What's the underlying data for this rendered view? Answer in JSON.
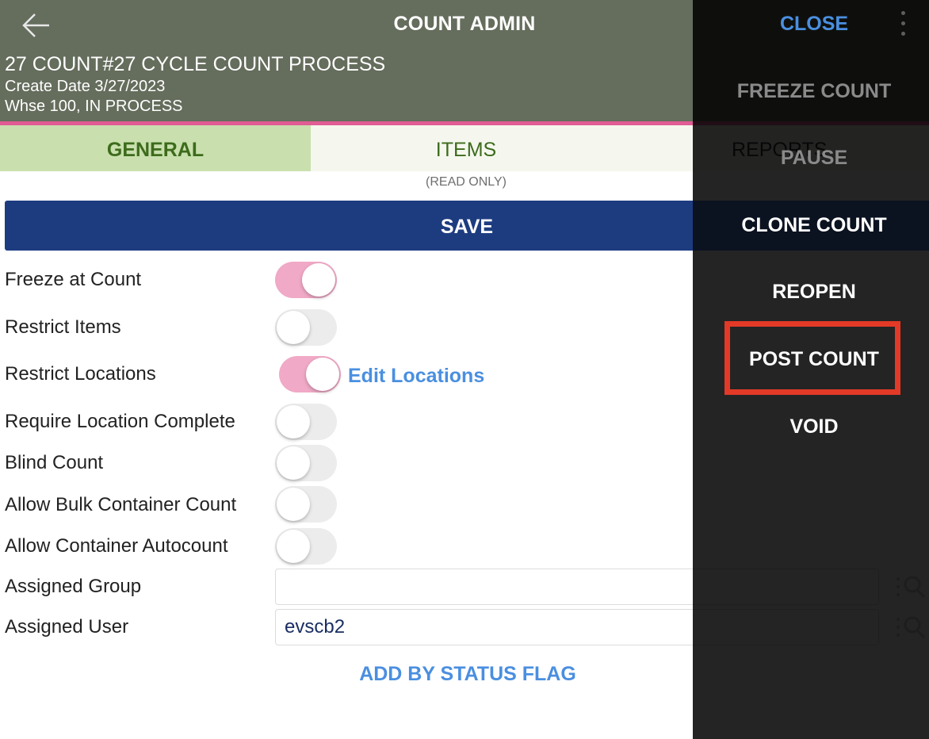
{
  "header": {
    "title": "COUNT ADMIN",
    "count_name": "27 COUNT#27 CYCLE COUNT PROCESS",
    "create_date": "Create Date 3/27/2023",
    "whse_status": "Whse 100, IN PROCESS",
    "back_icon": "arrow-left-icon"
  },
  "tabs": [
    {
      "label": "GENERAL",
      "active": true
    },
    {
      "label": "ITEMS",
      "active": false,
      "note": "(READ ONLY)"
    },
    {
      "label": "REPORTS",
      "active": false
    }
  ],
  "save_label": "SAVE",
  "form": {
    "toggles": [
      {
        "label": "Freeze at Count",
        "on": true
      },
      {
        "label": "Restrict Items",
        "on": false
      },
      {
        "label": "Restrict Locations",
        "on": true
      },
      {
        "label": "Require Location Complete",
        "on": false
      },
      {
        "label": "Blind Count",
        "on": false
      },
      {
        "label": "Allow Bulk Container Count",
        "on": false
      },
      {
        "label": "Allow Container Autocount",
        "on": false
      }
    ],
    "edit_locations_label": "Edit Locations",
    "assigned_group": {
      "label": "Assigned Group",
      "value": ""
    },
    "assigned_user": {
      "label": "Assigned User",
      "value": "evscb2"
    },
    "add_by_status_flag": "ADD BY STATUS FLAG"
  },
  "menu": {
    "close": "CLOSE",
    "items": [
      {
        "label": "FREEZE COUNT",
        "enabled": false
      },
      {
        "label": "PAUSE",
        "enabled": false
      },
      {
        "label": "CLONE COUNT",
        "enabled": true
      },
      {
        "label": "REOPEN",
        "enabled": true
      },
      {
        "label": "POST COUNT",
        "enabled": true,
        "highlighted": true
      },
      {
        "label": "VOID",
        "enabled": true
      }
    ]
  },
  "colors": {
    "header_bg": "#656d5c",
    "accent_pink": "#e05c93",
    "save_bg": "#1d3c80",
    "link_blue": "#4a8fe0",
    "highlight_red": "#e33a27"
  }
}
